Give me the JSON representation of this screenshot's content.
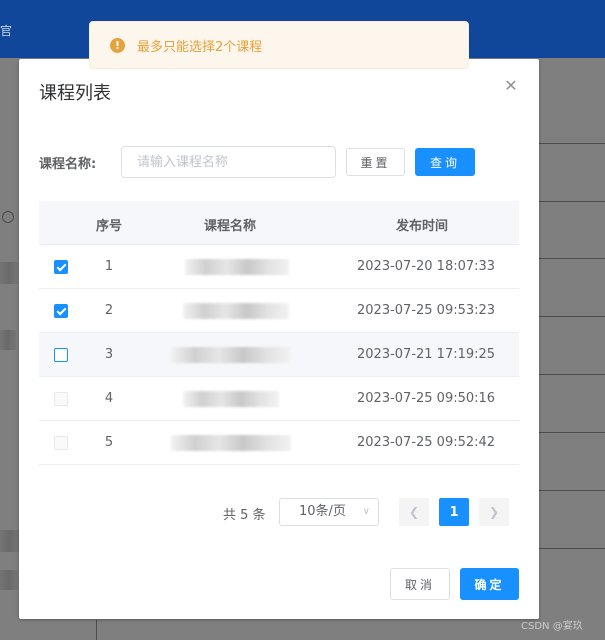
{
  "app": {
    "header_text": "官",
    "header_color": "#10479a"
  },
  "toast": {
    "icon": "warning-icon",
    "text": "最多只能选择2个课程",
    "color": "#e6a23c"
  },
  "dialog": {
    "title": "课程列表",
    "close_icon": "close-icon"
  },
  "search": {
    "label": "课程名称:",
    "placeholder": "请输入课程名称",
    "value": "",
    "reset_label": "重置",
    "query_label": "查询"
  },
  "table": {
    "headers": {
      "index": "序号",
      "name": "课程名称",
      "time": "发布时间"
    },
    "rows": [
      {
        "index": "1",
        "time": "2023-07-20 18:07:33",
        "state": "checked"
      },
      {
        "index": "2",
        "time": "2023-07-25 09:53:23",
        "state": "checked"
      },
      {
        "index": "3",
        "time": "2023-07-21 17:19:25",
        "state": "active"
      },
      {
        "index": "4",
        "time": "2023-07-25 09:50:16",
        "state": "disabled"
      },
      {
        "index": "5",
        "time": "2023-07-25 09:52:42",
        "state": "disabled"
      }
    ]
  },
  "pagination": {
    "total": "共 5 条",
    "page_size": "10条/页",
    "current_page": "1"
  },
  "footer": {
    "cancel_label": "取消",
    "confirm_label": "确定"
  },
  "watermark": "CSDN @宴玖",
  "colors": {
    "primary": "#1890ff",
    "warning": "#e6a23c"
  }
}
